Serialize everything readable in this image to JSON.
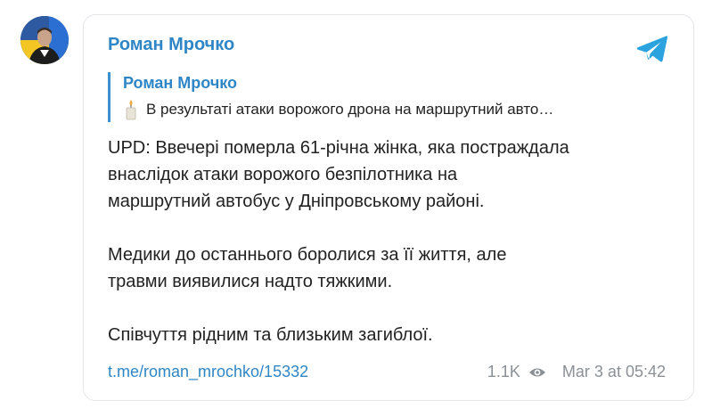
{
  "post": {
    "channel_name": "Роман Мрочко",
    "reply": {
      "author": "Роман Мрочко",
      "emoji": "🕯️",
      "snippet": "В результаті атаки ворожого дрона на маршрутний авто…"
    },
    "paragraphs": [
      [
        "UPD: Ввечері померла 61-річна жінка, яка постраждала",
        "внаслідок атаки ворожого безпілотника на",
        "маршрутний автобус у Дніпровському районі."
      ],
      [
        "Медики до останнього боролися за її життя, але",
        "травми виявилися надто тяжкими."
      ],
      [
        "Співчуття рідним та близьким загиблої."
      ]
    ],
    "link": "t.me/roman_mrochko/15332",
    "views": "1.1K",
    "date": "Mar 3 at 05:42"
  },
  "icons": {
    "avatar": "channel-avatar",
    "telegram": "telegram-icon",
    "views": "eye-icon",
    "reply_emoji": "candle-icon"
  },
  "colors": {
    "accent": "#2f86c6",
    "telegram_blue": "#2aa3de",
    "text": "#222222",
    "muted": "#8a9096",
    "border": "#e4e6ea"
  }
}
